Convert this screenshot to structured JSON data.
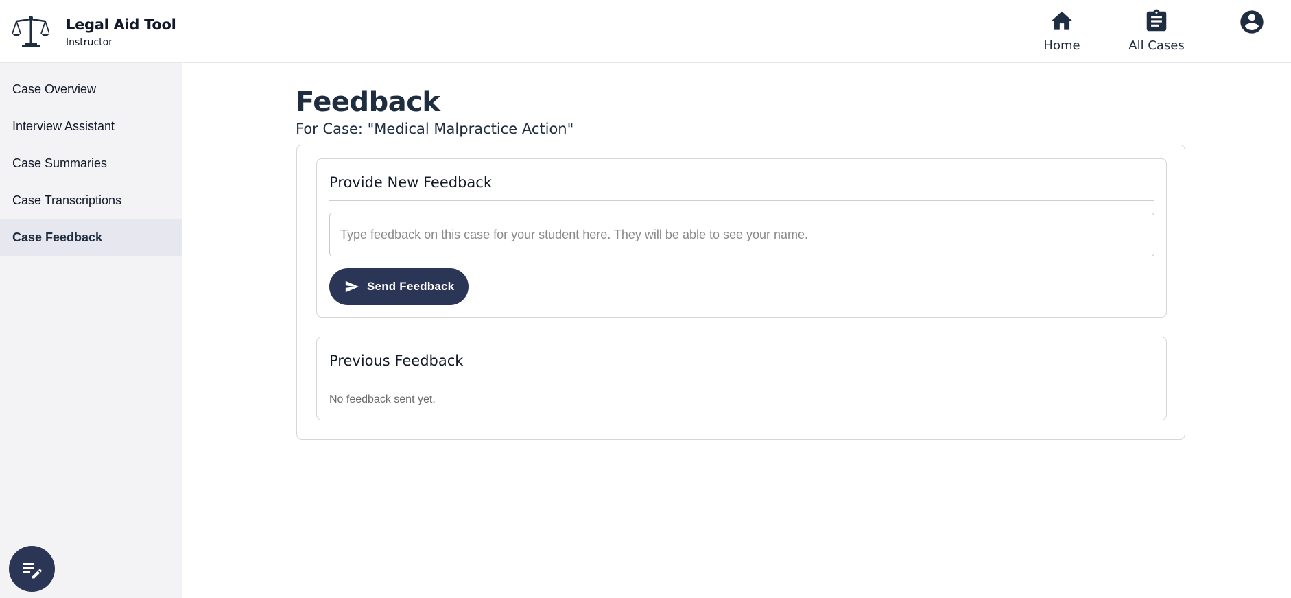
{
  "brand": {
    "title": "Legal Aid Tool",
    "subtitle": "Instructor",
    "logo_icon": "scales-icon"
  },
  "nav": {
    "home_label": "Home",
    "home_icon": "home-icon",
    "cases_label": "All Cases",
    "cases_icon": "clipboard-icon",
    "profile_icon": "account-circle-icon"
  },
  "sidebar": {
    "items": [
      {
        "label": "Case Overview",
        "active": false
      },
      {
        "label": "Interview Assistant",
        "active": false
      },
      {
        "label": "Case Summaries",
        "active": false
      },
      {
        "label": "Case Transcriptions",
        "active": false
      },
      {
        "label": "Case Feedback",
        "active": true
      }
    ],
    "fab_icon": "edit-notes-icon"
  },
  "main": {
    "title": "Feedback",
    "subtitle": "For Case: \"Medical Malpractice Action\"",
    "new_feedback": {
      "heading": "Provide New Feedback",
      "input_value": "",
      "input_placeholder": "Type feedback on this case for your student here. They will be able to see your name.",
      "send_label": "Send Feedback",
      "send_icon": "send-icon"
    },
    "previous_feedback": {
      "heading": "Previous Feedback",
      "empty_text": "No feedback sent yet."
    }
  },
  "colors": {
    "primary": "#2b3656",
    "heading": "#1f2d40",
    "sidebar_bg": "#f3f3f5",
    "sidebar_active_bg": "#e6e7ef"
  }
}
